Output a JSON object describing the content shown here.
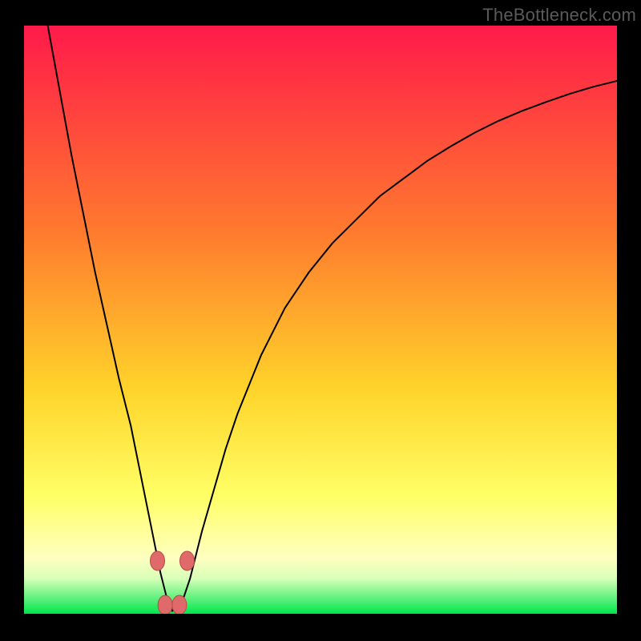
{
  "watermark": "TheBottleneck.com",
  "colors": {
    "frame": "#000000",
    "top": "#ff1a4a",
    "mid_upper": "#ff7a2e",
    "mid": "#ffd42a",
    "mid_lower": "#ffff66",
    "pale_yellow": "#ffffc0",
    "pale_green": "#d8ffb8",
    "green": "#00e64d",
    "curve": "#000000",
    "marker_fill": "#e06a6a",
    "marker_stroke": "#b84a4a"
  },
  "chart_data": {
    "type": "line",
    "title": "",
    "xlabel": "",
    "ylabel": "",
    "xlim": [
      0,
      100
    ],
    "ylim": [
      0,
      100
    ],
    "x_min_at": 25,
    "series": [
      {
        "name": "bottleneck-curve",
        "x": [
          4,
          6,
          8,
          10,
          12,
          14,
          16,
          18,
          20,
          21,
          22,
          23,
          24,
          25,
          26,
          27,
          28,
          29,
          30,
          32,
          34,
          36,
          38,
          40,
          44,
          48,
          52,
          56,
          60,
          64,
          68,
          72,
          76,
          80,
          84,
          88,
          92,
          96,
          100
        ],
        "y": [
          100,
          89,
          78,
          68,
          58,
          49,
          40,
          32,
          22,
          17,
          12,
          7,
          3,
          0.5,
          1,
          3,
          6,
          10,
          14,
          21,
          28,
          34,
          39,
          44,
          52,
          58,
          63,
          67,
          71,
          74,
          77,
          79.5,
          81.8,
          83.8,
          85.5,
          87,
          88.4,
          89.6,
          90.6
        ]
      }
    ],
    "markers": [
      {
        "x": 22.5,
        "y": 9
      },
      {
        "x": 27.5,
        "y": 9
      },
      {
        "x": 23.8,
        "y": 1.5
      },
      {
        "x": 26.2,
        "y": 1.5
      }
    ],
    "gradient_stops_pct": [
      {
        "at": 0,
        "color": "top"
      },
      {
        "at": 35,
        "color": "mid_upper"
      },
      {
        "at": 62,
        "color": "mid"
      },
      {
        "at": 80,
        "color": "mid_lower"
      },
      {
        "at": 90.5,
        "color": "pale_yellow"
      },
      {
        "at": 94,
        "color": "pale_green"
      },
      {
        "at": 100,
        "color": "green"
      }
    ]
  }
}
